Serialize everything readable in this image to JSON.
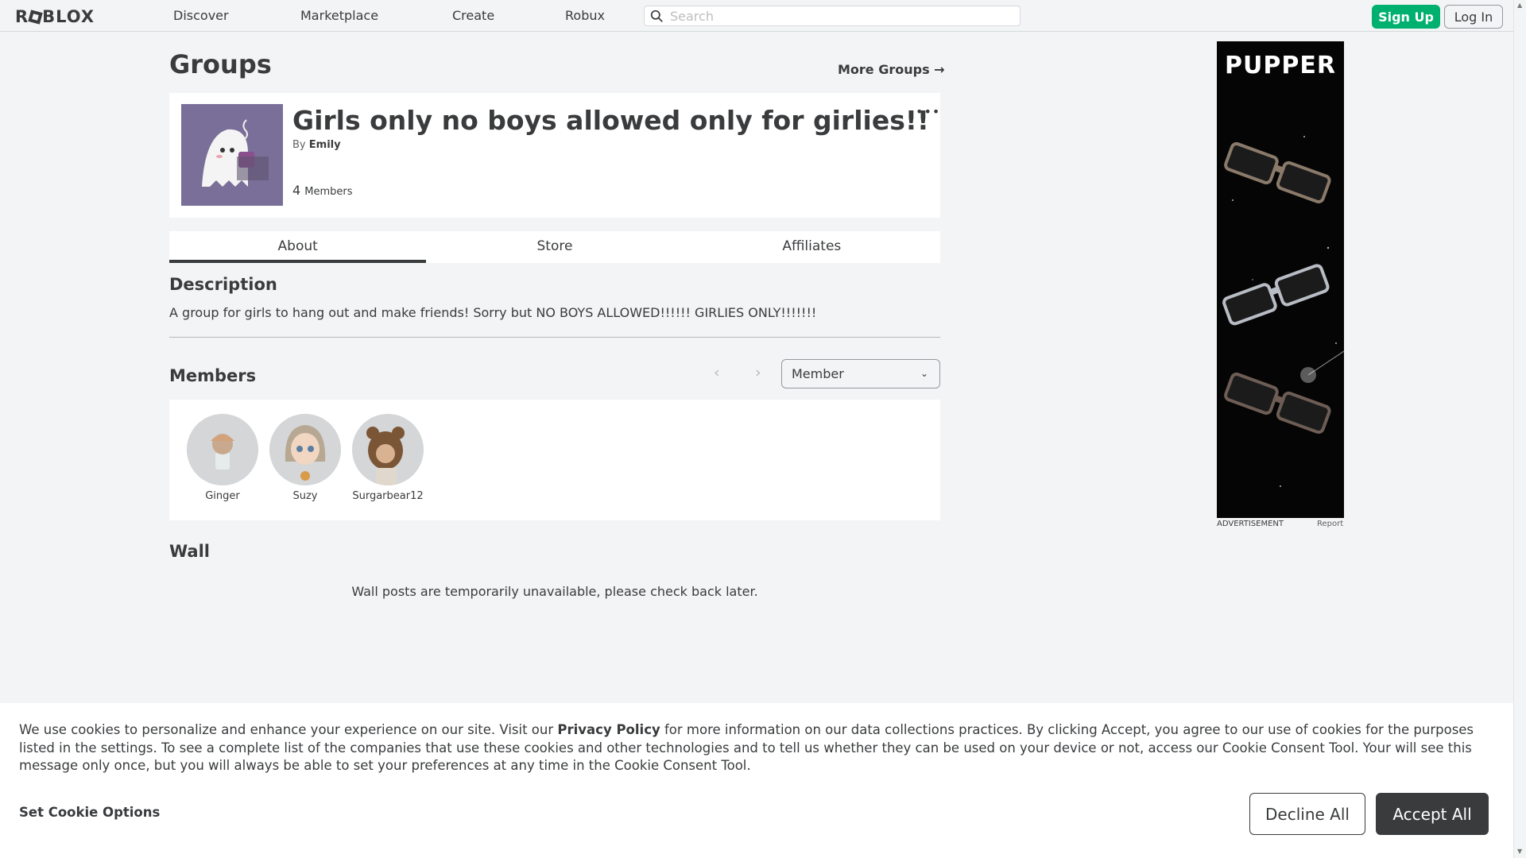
{
  "nav": {
    "logo": "ROBLOX",
    "links": [
      "Discover",
      "Marketplace",
      "Create",
      "Robux"
    ],
    "search_placeholder": "Search",
    "signup_label": "Sign Up",
    "login_label": "Log In"
  },
  "page": {
    "heading": "Groups",
    "more_groups": "More Groups →"
  },
  "group": {
    "title": "Girls only no boys allowed only for girlies!!",
    "by_label": "By",
    "owner": "Emily",
    "member_count": "4",
    "members_label": "Members",
    "more_icon": "more-horizontal-icon"
  },
  "tabs": [
    "About",
    "Store",
    "Affiliates"
  ],
  "description": {
    "heading": "Description",
    "text": "A group for girls to hang out and make friends! Sorry but NO BOYS ALLOWED!!!!!! GIRLIES ONLY!!!!!!!"
  },
  "members": {
    "heading": "Members",
    "role_selected": "Member",
    "list": [
      {
        "name": "Ginger",
        "color": "#c9a98d"
      },
      {
        "name": "Suzy",
        "color": "#b7a893"
      },
      {
        "name": "Surgarbear12",
        "color": "#7a5536"
      }
    ]
  },
  "wall": {
    "heading": "Wall",
    "message": "Wall posts are temporarily unavailable, please check back later."
  },
  "ad": {
    "brand": "PUPPER",
    "label": "ADVERTISEMENT",
    "report": "Report"
  },
  "cookie": {
    "text_before": "We use cookies to personalize and enhance your experience on our site. Visit our ",
    "link": "Privacy Policy",
    "text_after": " for more information on our data collections practices. By clicking Accept, you agree to our use of cookies for the purposes listed in the settings. To see a complete list of the companies that use these cookies and other technologies and to tell us whether they can be used on your device or not, access our Cookie Consent Tool. Your will see this message only once, but you will always be able to set your preferences at any time in the Cookie Consent Tool.",
    "options": "Set Cookie Options",
    "decline": "Decline All",
    "accept": "Accept All"
  },
  "colors": {
    "accent_green": "#00b06f",
    "text_dark": "#393b3d",
    "background": "#f2f4f5"
  }
}
